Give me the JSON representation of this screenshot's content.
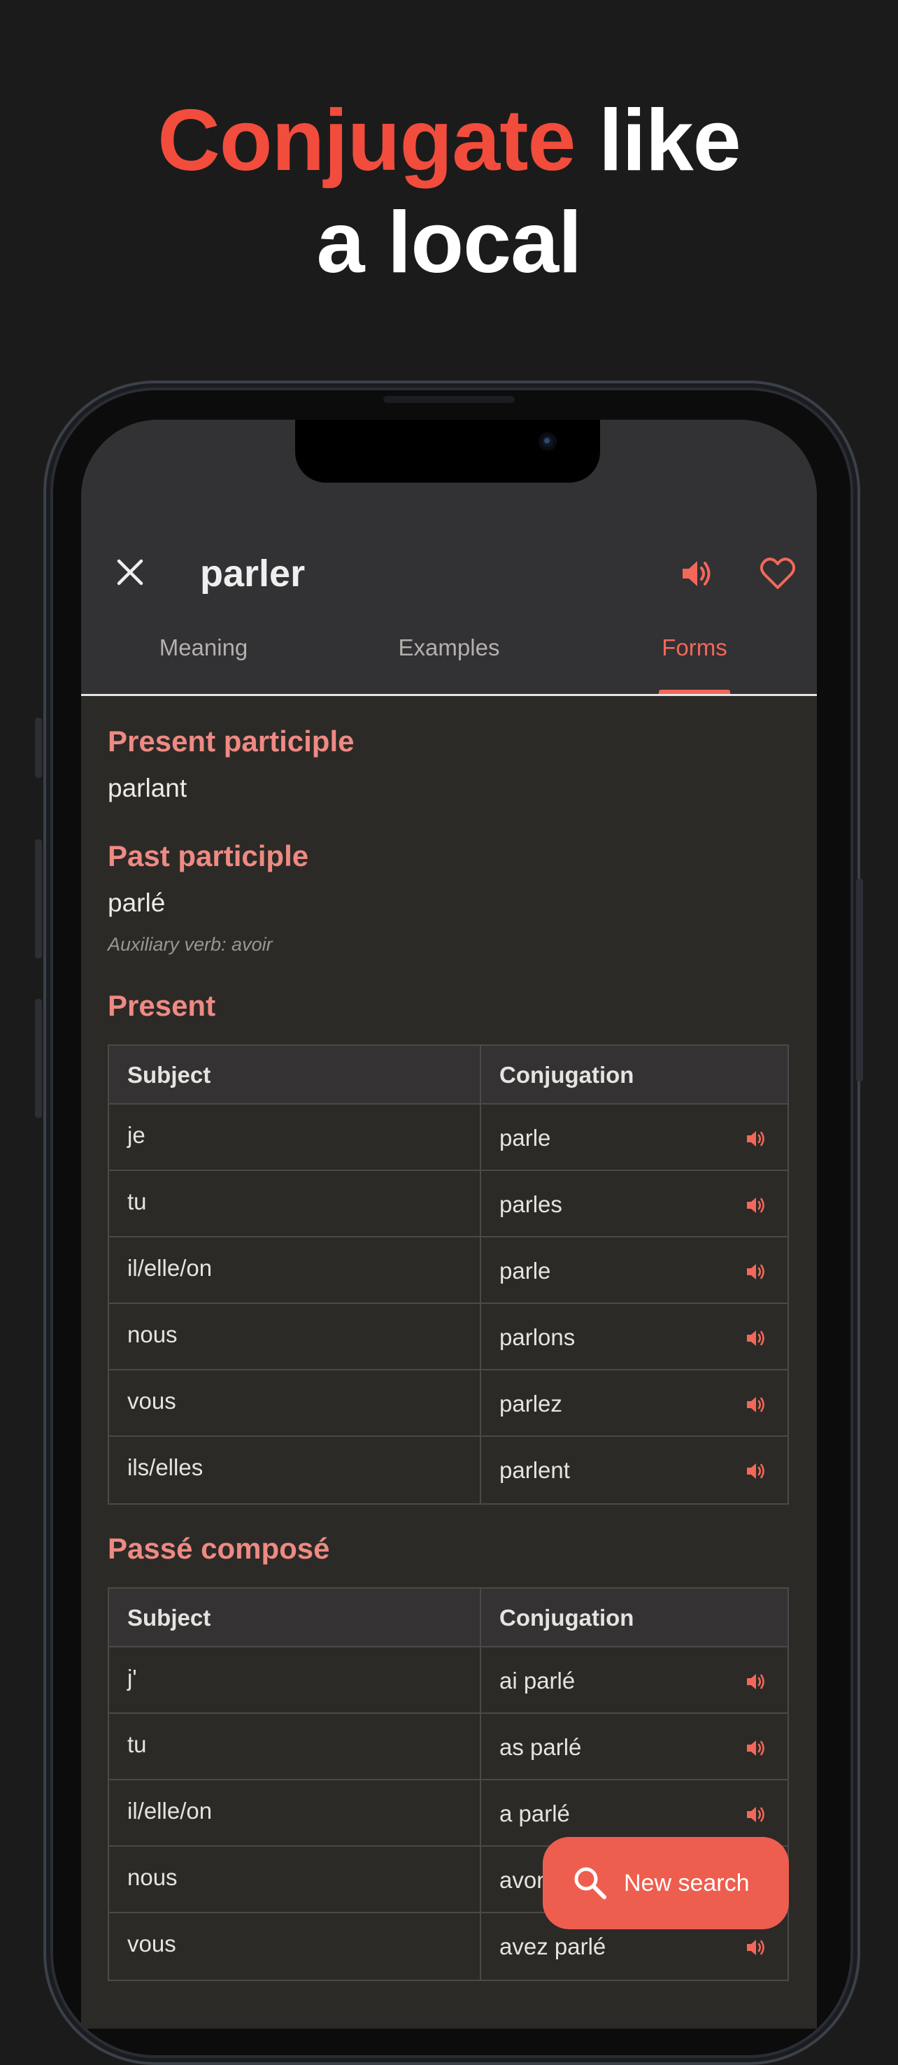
{
  "headline": {
    "accent": "Conjugate",
    "rest_line1": " like",
    "line2": "a local"
  },
  "colors": {
    "accent": "#f24c3d",
    "section": "#ee8a83",
    "icon": "#f2685a"
  },
  "appbar": {
    "title": "parler",
    "icons": {
      "close": "close-icon",
      "speaker": "speaker-icon",
      "favorite": "heart-icon"
    },
    "tabs": [
      {
        "label": "Meaning",
        "active": false
      },
      {
        "label": "Examples",
        "active": false
      },
      {
        "label": "Forms",
        "active": true
      }
    ]
  },
  "forms": {
    "present_participle": {
      "title": "Present participle",
      "value": "parlant"
    },
    "past_participle": {
      "title": "Past participle",
      "value": "parlé",
      "auxiliary": "Auxiliary verb: avoir"
    },
    "present": {
      "title": "Present",
      "headers": {
        "subject": "Subject",
        "conjugation": "Conjugation"
      },
      "rows": [
        {
          "subject": "je",
          "conjugation": "parle"
        },
        {
          "subject": "tu",
          "conjugation": "parles"
        },
        {
          "subject": "il/elle/on",
          "conjugation": "parle"
        },
        {
          "subject": "nous",
          "conjugation": "parlons"
        },
        {
          "subject": "vous",
          "conjugation": "parlez"
        },
        {
          "subject": "ils/elles",
          "conjugation": "parlent"
        }
      ]
    },
    "passe_compose": {
      "title": "Passé composé",
      "headers": {
        "subject": "Subject",
        "conjugation": "Conjugation"
      },
      "rows": [
        {
          "subject": "j'",
          "conjugation": "ai parlé"
        },
        {
          "subject": "tu",
          "conjugation": "as parlé"
        },
        {
          "subject": "il/elle/on",
          "conjugation": "a parlé"
        },
        {
          "subject": "nous",
          "conjugation": "avons parlé"
        },
        {
          "subject": "vous",
          "conjugation": "avez parlé"
        }
      ]
    }
  },
  "fab": {
    "label": "New search",
    "icon": "search-icon"
  }
}
